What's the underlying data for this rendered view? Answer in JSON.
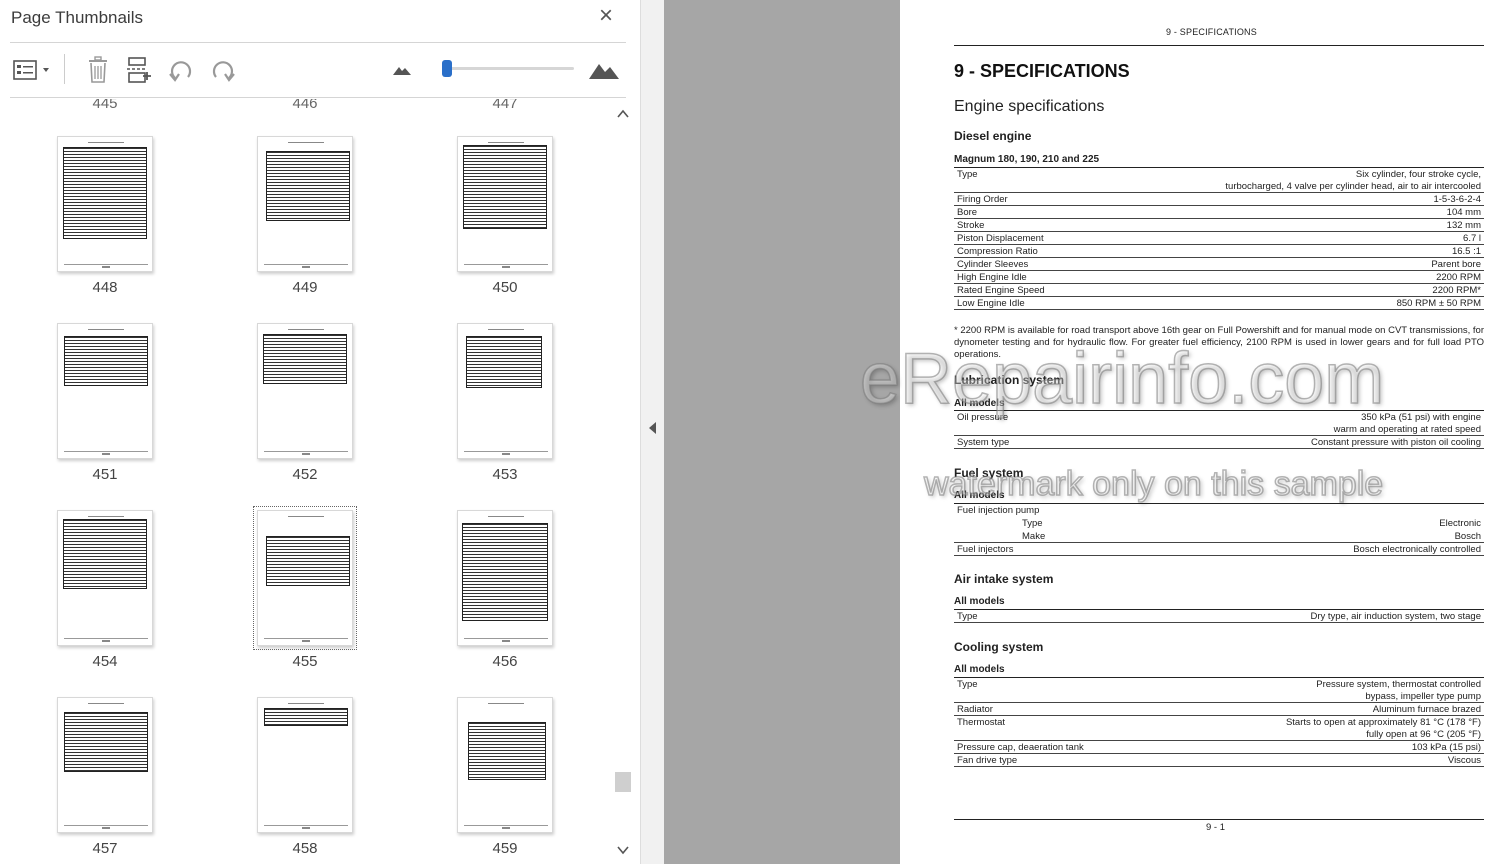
{
  "panel": {
    "title": "Page Thumbnails",
    "close_icon": "×",
    "toolbar": {
      "options_icon": "page-options-icon",
      "delete_icon": "trash-icon",
      "insert_icon": "insert-page-icon",
      "undo_icon": "rotate-counterclockwise-icon",
      "redo_icon": "rotate-clockwise-icon",
      "zoom_out_icon": "small-mountain-icon",
      "zoom_in_icon": "large-mountain-icon",
      "zoom_level": 0.04
    },
    "partial_labels": [
      "445",
      "446",
      "447"
    ],
    "thumbnails": [
      {
        "label": "448"
      },
      {
        "label": "449"
      },
      {
        "label": "450"
      },
      {
        "label": "451"
      },
      {
        "label": "452"
      },
      {
        "label": "453"
      },
      {
        "label": "454"
      },
      {
        "label": "455",
        "selected": true
      },
      {
        "label": "456"
      },
      {
        "label": "457"
      },
      {
        "label": "458"
      },
      {
        "label": "459"
      }
    ]
  },
  "document": {
    "header": "9 - SPECIFICATIONS",
    "title": "9 - SPECIFICATIONS",
    "subtitle": "Engine specifications",
    "diesel": {
      "heading": "Diesel engine",
      "models": "Magnum 180, 190, 210 and 225",
      "rows": [
        {
          "label": "Type",
          "value": "Six cylinder, four stroke cycle,",
          "value2": "turbocharged, 4 valve per cylinder head, air to air intercooled"
        },
        {
          "label": "Firing Order",
          "value": "1-5-3-6-2-4"
        },
        {
          "label": "Bore",
          "value": "104 mm"
        },
        {
          "label": "Stroke",
          "value": "132 mm"
        },
        {
          "label": "Piston Displacement",
          "value": "6.7 l"
        },
        {
          "label": "Compression Ratio",
          "value": "16.5 :1"
        },
        {
          "label": "Cylinder Sleeves",
          "value": "Parent bore"
        },
        {
          "label": "High Engine Idle",
          "value": "2200 RPM"
        },
        {
          "label": "Rated Engine Speed",
          "value": "2200 RPM*"
        },
        {
          "label": "Low Engine Idle",
          "value": "850 RPM ± 50 RPM"
        }
      ],
      "footnote": "* 2200 RPM is available for road transport above 16th gear on Full Powershift and for manual mode on CVT transmissions, for dynometer testing and for hydraulic flow. For greater fuel efficiency, 2100 RPM is used in lower gears and for full load PTO operations."
    },
    "lubrication": {
      "heading": "Lubrication system",
      "models": "All models",
      "rows": [
        {
          "label": "Oil pressure",
          "value": "350 kPa (51 psi) with engine",
          "value2": "warm and operating at rated speed"
        },
        {
          "label": "System type",
          "value": "Constant pressure with piston oil cooling"
        }
      ]
    },
    "fuel": {
      "heading": "Fuel system",
      "models": "All models",
      "pump_label": "Fuel injection pump",
      "pump_type_label": "Type",
      "pump_type_value": "Electronic",
      "pump_make_label": "Make",
      "pump_make_value": "Bosch",
      "injectors_label": "Fuel injectors",
      "injectors_value": "Bosch electronically controlled"
    },
    "air": {
      "heading": "Air intake system",
      "models": "All models",
      "type_label": "Type",
      "type_value": "Dry type, air induction system, two stage"
    },
    "cooling": {
      "heading": "Cooling system",
      "models": "All models",
      "rows": [
        {
          "label": "Type",
          "value": "Pressure system, thermostat controlled",
          "value2": "bypass, impeller type pump"
        },
        {
          "label": "Radiator",
          "value": "Aluminum furnace brazed"
        },
        {
          "label": "Thermostat",
          "value": "Starts to open at approximately 81 °C (178 °F)",
          "value2": "fully open at 96 °C (205 °F)"
        },
        {
          "label": "Pressure cap, deaeration tank",
          "value": "103 kPa (15 psi)"
        },
        {
          "label": "Fan drive type",
          "value": "Viscous"
        }
      ]
    },
    "page_number": "9 - 1"
  },
  "watermark": {
    "main": "eRepairinfo.com",
    "sub": "watermark only on this sample"
  }
}
